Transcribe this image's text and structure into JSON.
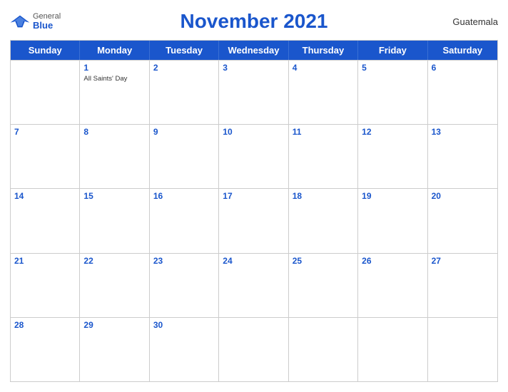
{
  "header": {
    "title": "November 2021",
    "country": "Guatemala",
    "logo": {
      "general": "General",
      "blue": "Blue"
    }
  },
  "days_of_week": [
    "Sunday",
    "Monday",
    "Tuesday",
    "Wednesday",
    "Thursday",
    "Friday",
    "Saturday"
  ],
  "weeks": [
    [
      {
        "num": "",
        "event": ""
      },
      {
        "num": "1",
        "event": "All Saints' Day"
      },
      {
        "num": "2",
        "event": ""
      },
      {
        "num": "3",
        "event": ""
      },
      {
        "num": "4",
        "event": ""
      },
      {
        "num": "5",
        "event": ""
      },
      {
        "num": "6",
        "event": ""
      }
    ],
    [
      {
        "num": "7",
        "event": ""
      },
      {
        "num": "8",
        "event": ""
      },
      {
        "num": "9",
        "event": ""
      },
      {
        "num": "10",
        "event": ""
      },
      {
        "num": "11",
        "event": ""
      },
      {
        "num": "12",
        "event": ""
      },
      {
        "num": "13",
        "event": ""
      }
    ],
    [
      {
        "num": "14",
        "event": ""
      },
      {
        "num": "15",
        "event": ""
      },
      {
        "num": "16",
        "event": ""
      },
      {
        "num": "17",
        "event": ""
      },
      {
        "num": "18",
        "event": ""
      },
      {
        "num": "19",
        "event": ""
      },
      {
        "num": "20",
        "event": ""
      }
    ],
    [
      {
        "num": "21",
        "event": ""
      },
      {
        "num": "22",
        "event": ""
      },
      {
        "num": "23",
        "event": ""
      },
      {
        "num": "24",
        "event": ""
      },
      {
        "num": "25",
        "event": ""
      },
      {
        "num": "26",
        "event": ""
      },
      {
        "num": "27",
        "event": ""
      }
    ],
    [
      {
        "num": "28",
        "event": ""
      },
      {
        "num": "29",
        "event": ""
      },
      {
        "num": "30",
        "event": ""
      },
      {
        "num": "",
        "event": ""
      },
      {
        "num": "",
        "event": ""
      },
      {
        "num": "",
        "event": ""
      },
      {
        "num": "",
        "event": ""
      }
    ]
  ]
}
